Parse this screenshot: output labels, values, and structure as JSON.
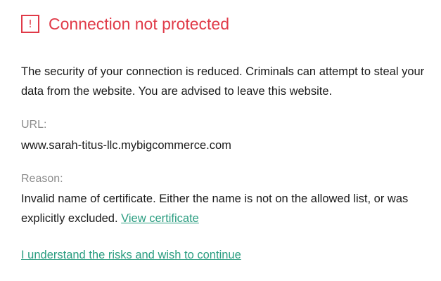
{
  "header": {
    "icon": "warning-exclamation-icon",
    "icon_glyph": "!",
    "title": "Connection not protected",
    "accent_color": "#e03a48"
  },
  "description": "The security of your connection is reduced. Criminals can attempt to steal your data from the website. You are advised to leave this website.",
  "url": {
    "label": "URL:",
    "value": "www.sarah-titus-llc.mybigcommerce.com"
  },
  "reason": {
    "label": "Reason:",
    "text": "Invalid name of certificate. Either the name is not on the allowed list, or was explicitly excluded.",
    "view_certificate_link": "View certificate"
  },
  "continue_link": "I understand the risks and wish to continue",
  "link_color": "#2a9d80"
}
